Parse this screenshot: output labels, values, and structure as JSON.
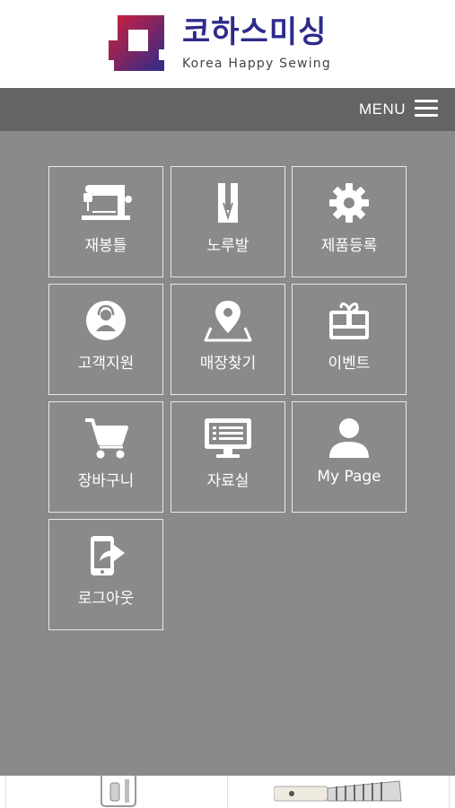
{
  "brand": {
    "name_ko": "코하스미싱",
    "name_en": "Korea Happy Sewing",
    "colors": {
      "primary": "#2d2b8a",
      "accent": "#d2203a"
    }
  },
  "menubar": {
    "label": "MENU",
    "icon": "hamburger-icon"
  },
  "menu_items": [
    {
      "label": "재봉틀",
      "icon": "sewing-machine-icon"
    },
    {
      "label": "노루발",
      "icon": "presser-foot-icon"
    },
    {
      "label": "제품등록",
      "icon": "gear-icon"
    },
    {
      "label": "고객지원",
      "icon": "customer-support-icon"
    },
    {
      "label": "매장찾기",
      "icon": "map-pin-icon"
    },
    {
      "label": "이벤트",
      "icon": "gift-icon"
    },
    {
      "label": "장바구니",
      "icon": "cart-icon"
    },
    {
      "label": "자료실",
      "icon": "monitor-icon"
    },
    {
      "label": "My Page",
      "icon": "user-icon"
    },
    {
      "label": "로그아웃",
      "icon": "logout-icon"
    }
  ],
  "colors": {
    "overlay": "#8a8a8a",
    "menubar": "#646464",
    "tile_border": "#e8e8e8"
  }
}
